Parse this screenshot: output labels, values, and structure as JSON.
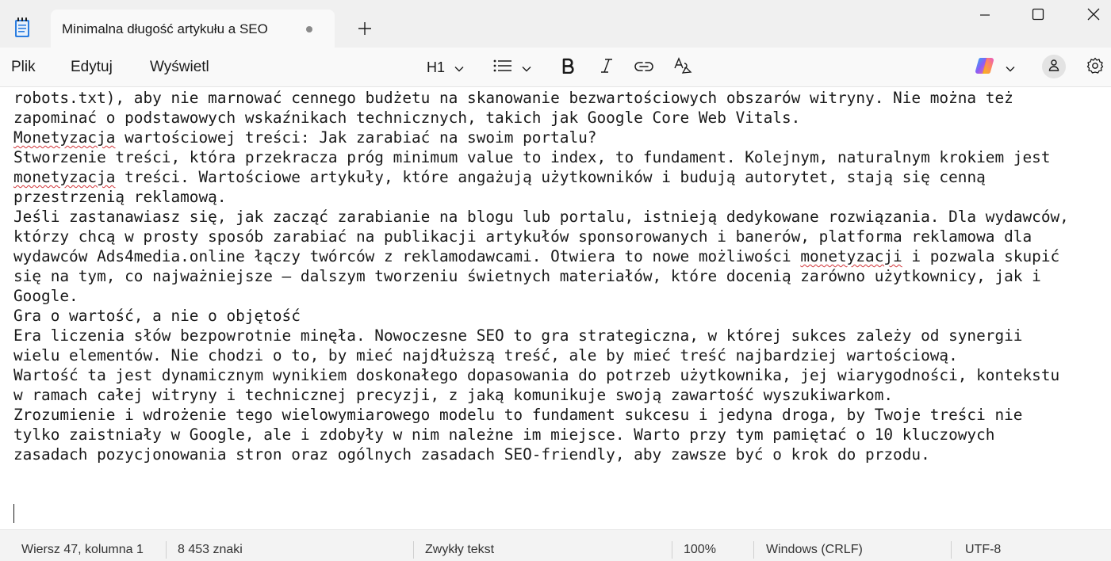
{
  "window": {
    "tab_title": "Minimalna długość artykułu a SEO",
    "new_tab_symbol": "+",
    "icons": [
      "notepad-app-icon",
      "unsaved-dot-icon",
      "plus-icon",
      "minimize-icon",
      "maximize-icon",
      "close-icon"
    ]
  },
  "menu": {
    "file": "Plik",
    "edit": "Edytuj",
    "view": "Wyświetl"
  },
  "toolbar": {
    "heading_label": "H1",
    "icons": [
      "chevron-down-icon",
      "list-icon",
      "bold-icon",
      "italic-icon",
      "link-icon",
      "clear-formatting-icon",
      "copilot-icon",
      "account-icon",
      "settings-gear-icon"
    ]
  },
  "editor": {
    "lines": [
      [
        {
          "t": "robots.txt), aby nie marnować cennego budżetu na skanowanie bezwartościowych obszarów witryny. Nie można też"
        }
      ],
      [
        {
          "t": "zapominać o podstawowych wskaźnikach technicznych, takich jak Google Core Web Vitals."
        }
      ],
      [
        {
          "t": "Monetyzacja",
          "err": true
        },
        {
          "t": " wartościowej treści: Jak zarabiać na swoim portalu?"
        }
      ],
      [
        {
          "t": "Stworzenie treści, która przekracza próg minimum value to index, to fundament. Kolejnym, naturalnym krokiem jest"
        }
      ],
      [
        {
          "t": "monetyzacja",
          "err": true
        },
        {
          "t": " treści. Wartościowe artykuły, które angażują użytkowników i budują autorytet, stają się cenną"
        }
      ],
      [
        {
          "t": "przestrzenią reklamową."
        }
      ],
      [
        {
          "t": "Jeśli zastanawiasz się, jak zacząć zarabianie na blogu lub portalu, istnieją dedykowane rozwiązania. Dla wydawców,"
        }
      ],
      [
        {
          "t": "którzy chcą w prosty sposób zarabiać na publikacji artykułów sponsorowanych i banerów, platforma reklamowa dla"
        }
      ],
      [
        {
          "t": "wydawców Ads4media.online łączy twórców z reklamodawcami. Otwiera to nowe możliwości "
        },
        {
          "t": "monetyzacji",
          "err": true
        },
        {
          "t": " i pozwala skupić"
        }
      ],
      [
        {
          "t": "się na tym, co najważniejsze – dalszym tworzeniu świetnych materiałów, które docenią zarówno użytkownicy, jak i"
        }
      ],
      [
        {
          "t": "Google."
        }
      ],
      [
        {
          "t": "Gra o wartość, a nie o objętość"
        }
      ],
      [
        {
          "t": "Era liczenia słów bezpowrotnie minęła. Nowoczesne SEO to gra strategiczna, w której sukces zależy od synergii"
        }
      ],
      [
        {
          "t": "wielu elementów. Nie chodzi o to, by mieć najdłuższą treść, ale by mieć treść najbardziej wartościową."
        }
      ],
      [
        {
          "t": "Wartość ta jest dynamicznym wynikiem doskonałego dopasowania do potrzeb użytkownika, jej wiarygodności, kontekstu"
        }
      ],
      [
        {
          "t": "w ramach całej witryny i technicznej precyzji, z jaką komunikuje swoją zawartość wyszukiwarkom."
        }
      ],
      [
        {
          "t": "Zrozumienie i wdrożenie tego wielowymiarowego modelu to fundament sukcesu i jedyna droga, by Twoje treści nie"
        }
      ],
      [
        {
          "t": "tylko zaistniały w Google, ale i zdobyły w nim należne im miejsce. Warto przy tym pamiętać o 10 kluczowych"
        }
      ],
      [
        {
          "t": "zasadach pozycjonowania stron oraz ogólnych zasadach SEO-friendly, aby zawsze być o krok do przodu."
        }
      ]
    ]
  },
  "status": {
    "position": "Wiersz 47, kolumna 1",
    "chars": "8 453 znaki",
    "format": "Zwykły tekst",
    "zoom": "100%",
    "line_endings": "Windows (CRLF)",
    "encoding": "UTF-8"
  },
  "colors": {
    "titlebar_bg": "#f0f0f0",
    "toolbar_bg": "#f9f9f9",
    "spell_error": "#d13438",
    "status_bg": "#f3f3f3"
  }
}
